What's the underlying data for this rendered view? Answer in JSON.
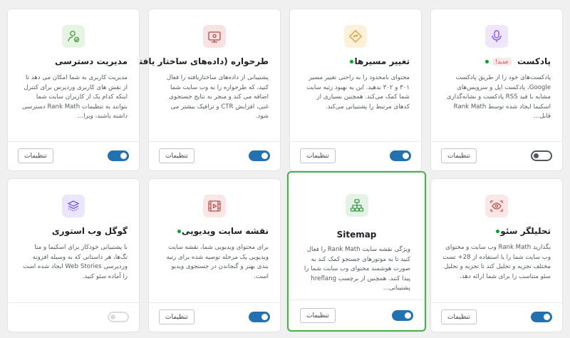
{
  "settings_label": "تنظیمات",
  "new_badge": "جدید!",
  "cards": [
    {
      "title": "پادکست",
      "icon": "microphone-icon",
      "description": "پادکست‌های خود را از طریق پادکست Google، پادکست اپل و سرویس‌های مشابه با فید RSS پادکست و نشانه‌گذاری اسکیما ایجاد شده توسط Rank Math قابل...",
      "enabled": false
    },
    {
      "title": "تغییر مسیرها",
      "icon": "redirect-icon",
      "description": "محتوای نامحدود را به راحتی تغییر مسیر ۳۰۱ و ۳۰۲ بدهید. این به بهبود رتبه سایت شما کمک می‌کند. همچنین بسیاری از کدهای مرتبط را پشتیبانی می‌کند.",
      "enabled": true
    },
    {
      "title": "طرحواره (داده‌های ساختار یافته)",
      "icon": "schema-icon",
      "description": "پشتیبانی از داده‌های ساختاریافته را فعال کنید، که طرحواره را به وب سایت شما اضافه می کند و منجر به نتایج جستجوی غنی، افزایش CTR و ترافیک بیشتر می شود.",
      "enabled": true
    },
    {
      "title": "مدیریت دسترسی",
      "icon": "user-access-icon",
      "description": "مدیریت کاربری به شما امکان می دهد تا از نقش های کاربری وردپرس برای کنترل اینکه کدام یک از کاربران سایت شما بتوانند به تنظیمات Rank Math دسترسی داشته باشند، ویرا...",
      "enabled": true
    },
    {
      "title": "تحلیلگر سئو",
      "icon": "eye-scan-icon",
      "description": "بگذارید Rank Math وب سایت و محتوای وب سایت شما را با استفاده از 28+ تست مختلف تجزیه و تحلیل کند تا تجزیه و تحلیل سئو متناسب را برای شما ارائه دهد.",
      "enabled": true
    },
    {
      "title": "Sitemap",
      "icon": "sitemap-icon",
      "description": "ویژگی نقشه سایت Rank Math را فعال کنید تا به موتورهای جستجو کمک کند به صورت هوشمند محتوای وب سایت شما را پیدا کنند. همچنین از برچسب hreflang پشتیبانی...",
      "enabled": true
    },
    {
      "title": "نقشه سایت ویدیویی",
      "icon": "video-icon",
      "description": "برای محتوای ویدیویی شما، نقشه سایت ویدیویی یک مرحله توصیه شده برای رتبه بندی بهتر و گنجاندن در جستجوی ویدیو است.",
      "enabled": true
    },
    {
      "title": "گوگل وب استوری",
      "icon": "web-stories-icon",
      "description": "با پشتیبانی خودکار برای اسکیما و متا تگ‌ها، هر داستانی که به وسیله افزونه وردپرسی Web Stories ایجاد شده است را آماده سئو کنید.",
      "enabled": false
    }
  ],
  "colors": {
    "accent": "#2271b1",
    "active_dot": "#00a32a",
    "highlight_border": "#4caf50"
  }
}
